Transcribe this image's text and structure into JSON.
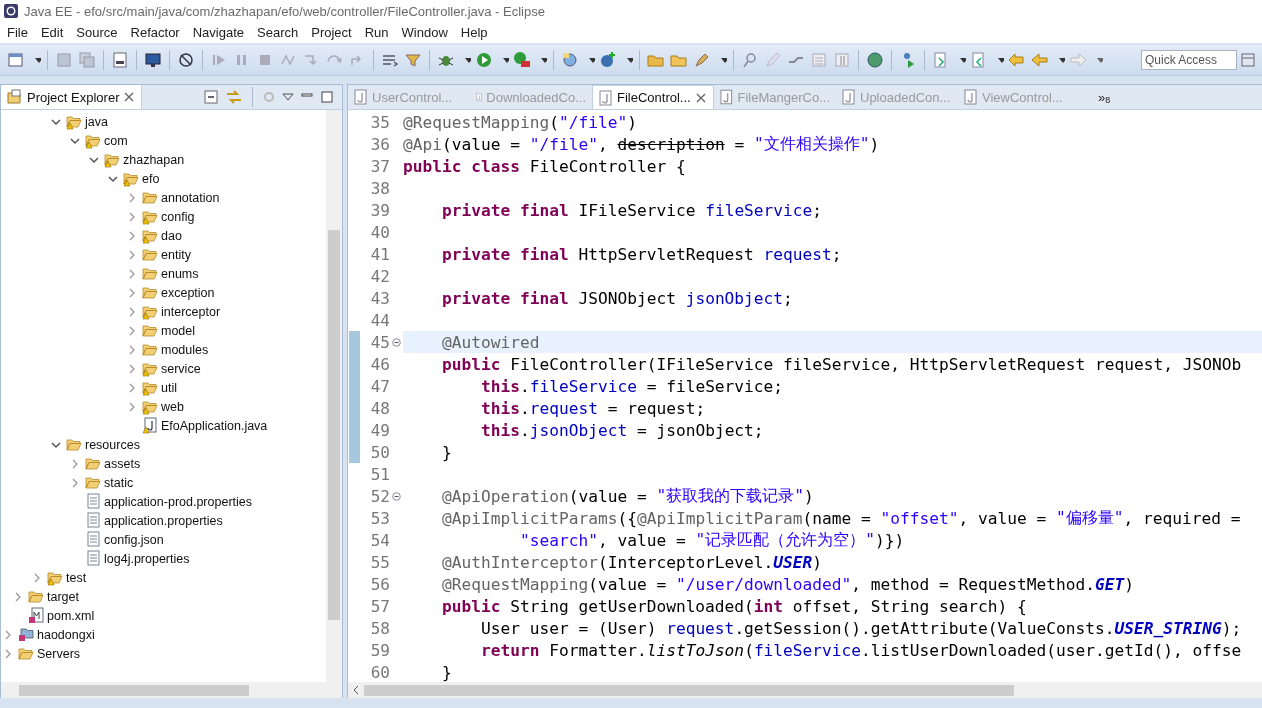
{
  "window": {
    "title": "Java EE - efo/src/main/java/com/zhazhapan/efo/web/controller/FileController.java - Eclipse"
  },
  "menu": [
    "File",
    "Edit",
    "Source",
    "Refactor",
    "Navigate",
    "Search",
    "Project",
    "Run",
    "Window",
    "Help"
  ],
  "quick_access": {
    "placeholder": "Quick Access"
  },
  "explorer": {
    "title": "Project Explorer",
    "tree": [
      {
        "children": [
          {
            "children": [
              {
                "children": [
                  {
                    "label": "java",
                    "kind": "folder",
                    "warning": true,
                    "expanded": true,
                    "children": [
                      {
                        "label": "com",
                        "kind": "folder",
                        "warning": true,
                        "expanded": true,
                        "children": [
                          {
                            "label": "zhazhapan",
                            "kind": "folder",
                            "warning": true,
                            "expanded": true,
                            "children": [
                              {
                                "label": "efo",
                                "kind": "folder",
                                "warning": true,
                                "expanded": true,
                                "children": [
                                  {
                                    "label": "annotation",
                                    "kind": "folder",
                                    "warning": false,
                                    "expanded": false
                                  },
                                  {
                                    "label": "config",
                                    "kind": "folder",
                                    "warning": true,
                                    "expanded": false
                                  },
                                  {
                                    "label": "dao",
                                    "kind": "folder",
                                    "warning": true,
                                    "expanded": false
                                  },
                                  {
                                    "label": "entity",
                                    "kind": "folder",
                                    "warning": false,
                                    "expanded": false
                                  },
                                  {
                                    "label": "enums",
                                    "kind": "folder",
                                    "warning": false,
                                    "expanded": false
                                  },
                                  {
                                    "label": "exception",
                                    "kind": "folder",
                                    "warning": false,
                                    "expanded": false
                                  },
                                  {
                                    "label": "interceptor",
                                    "kind": "folder",
                                    "warning": true,
                                    "expanded": false
                                  },
                                  {
                                    "label": "model",
                                    "kind": "folder",
                                    "warning": false,
                                    "expanded": false
                                  },
                                  {
                                    "label": "modules",
                                    "kind": "folder",
                                    "warning": false,
                                    "expanded": false
                                  },
                                  {
                                    "label": "service",
                                    "kind": "folder",
                                    "warning": true,
                                    "expanded": false
                                  },
                                  {
                                    "label": "util",
                                    "kind": "folder",
                                    "warning": true,
                                    "expanded": false
                                  },
                                  {
                                    "label": "web",
                                    "kind": "folder",
                                    "warning": true,
                                    "expanded": false
                                  },
                                  {
                                    "label": "EfoApplication.java",
                                    "kind": "java-file",
                                    "warning": true
                                  }
                                ]
                              }
                            ]
                          }
                        ]
                      }
                    ]
                  },
                  {
                    "label": "resources",
                    "kind": "folder",
                    "warning": false,
                    "expanded": true,
                    "children": [
                      {
                        "label": "assets",
                        "kind": "folder",
                        "warning": false,
                        "expanded": false
                      },
                      {
                        "label": "static",
                        "kind": "folder",
                        "warning": false,
                        "expanded": false
                      },
                      {
                        "label": "application-prod.properties",
                        "kind": "text-file",
                        "warning": false
                      },
                      {
                        "label": "application.properties",
                        "kind": "text-file",
                        "warning": false
                      },
                      {
                        "label": "config.json",
                        "kind": "text-file",
                        "warning": false
                      },
                      {
                        "label": "log4j.properties",
                        "kind": "text-file",
                        "warning": false
                      }
                    ]
                  }
                ]
              },
              {
                "label": "test",
                "kind": "folder",
                "warning": true,
                "expanded": false
              }
            ]
          },
          {
            "label": "target",
            "kind": "folder",
            "warning": false,
            "expanded": false
          },
          {
            "label": "pom.xml",
            "kind": "xml-file",
            "warning": false
          }
        ]
      },
      {
        "label": "haodongxi",
        "kind": "project",
        "warning": false,
        "expanded": false
      },
      {
        "label": "Servers",
        "kind": "folder",
        "warning": false,
        "expanded": false
      }
    ]
  },
  "editor_tabs": [
    {
      "label": "UserControl...",
      "selected": false
    },
    {
      "label": "DownloadedCo...",
      "selected": false
    },
    {
      "label": "FileControl...",
      "selected": true
    },
    {
      "label": "FileMangerCo...",
      "selected": false
    },
    {
      "label": "UploadedCon...",
      "selected": false
    },
    {
      "label": "ViewControl...",
      "selected": false
    }
  ],
  "hidden_tabs": {
    "arrow": "»",
    "count": "8"
  },
  "code": [
    {
      "n": "35",
      "current": false,
      "changed": false,
      "fold": false,
      "tokens": [
        {
          "kind": "annotation",
          "t": "@RequestMapping"
        },
        {
          "kind": "plain",
          "t": "("
        },
        {
          "kind": "string",
          "t": "\"/file\""
        },
        {
          "kind": "plain",
          "t": ")"
        }
      ]
    },
    {
      "n": "36",
      "current": false,
      "changed": false,
      "fold": false,
      "tokens": [
        {
          "kind": "annotation",
          "t": "@Api"
        },
        {
          "kind": "plain",
          "t": "(value = "
        },
        {
          "kind": "string",
          "t": "\"/file\""
        },
        {
          "kind": "plain",
          "t": ", "
        },
        {
          "kind": "deprecated",
          "t": "description"
        },
        {
          "kind": "plain",
          "t": " = "
        },
        {
          "kind": "string",
          "t": "\"文件相关操作\""
        },
        {
          "kind": "plain",
          "t": ")"
        }
      ]
    },
    {
      "n": "37",
      "current": false,
      "changed": false,
      "fold": false,
      "tokens": [
        {
          "kind": "keyword",
          "t": "public class "
        },
        {
          "kind": "plain",
          "t": "FileController {"
        }
      ]
    },
    {
      "n": "38",
      "current": false,
      "changed": false,
      "fold": false
    },
    {
      "n": "39",
      "current": false,
      "changed": false,
      "fold": false,
      "tokens": [
        {
          "kind": "keyword",
          "t": "    private final "
        },
        {
          "kind": "plain",
          "t": "IFileService "
        },
        {
          "kind": "field",
          "t": "fileService"
        },
        {
          "kind": "plain",
          "t": ";"
        }
      ]
    },
    {
      "n": "40",
      "current": false,
      "changed": false,
      "fold": false
    },
    {
      "n": "41",
      "current": false,
      "changed": false,
      "fold": false,
      "tokens": [
        {
          "kind": "keyword",
          "t": "    private final "
        },
        {
          "kind": "plain",
          "t": "HttpServletRequest "
        },
        {
          "kind": "field",
          "t": "request"
        },
        {
          "kind": "plain",
          "t": ";"
        }
      ]
    },
    {
      "n": "42",
      "current": false,
      "changed": false,
      "fold": false
    },
    {
      "n": "43",
      "current": false,
      "changed": false,
      "fold": false,
      "tokens": [
        {
          "kind": "keyword",
          "t": "    private final "
        },
        {
          "kind": "plain",
          "t": "JSONObject "
        },
        {
          "kind": "field",
          "t": "jsonObject"
        },
        {
          "kind": "plain",
          "t": ";"
        }
      ]
    },
    {
      "n": "44",
      "current": false,
      "changed": false,
      "fold": false
    },
    {
      "n": "45",
      "current": true,
      "changed": true,
      "fold": true,
      "tokens": [
        {
          "kind": "annotation",
          "t": "    @Autowired"
        }
      ]
    },
    {
      "n": "46",
      "current": false,
      "changed": true,
      "fold": false,
      "tokens": [
        {
          "kind": "keyword",
          "t": "    public "
        },
        {
          "kind": "plain",
          "t": "FileController(IFileService fileService, HttpServletRequest request, JSONOb"
        }
      ]
    },
    {
      "n": "47",
      "current": false,
      "changed": true,
      "fold": false,
      "tokens": [
        {
          "kind": "keyword",
          "t": "        this"
        },
        {
          "kind": "plain",
          "t": "."
        },
        {
          "kind": "field",
          "t": "fileService"
        },
        {
          "kind": "plain",
          "t": " = fileService;"
        }
      ]
    },
    {
      "n": "48",
      "current": false,
      "changed": true,
      "fold": false,
      "tokens": [
        {
          "kind": "keyword",
          "t": "        this"
        },
        {
          "kind": "plain",
          "t": "."
        },
        {
          "kind": "field",
          "t": "request"
        },
        {
          "kind": "plain",
          "t": " = request;"
        }
      ]
    },
    {
      "n": "49",
      "current": false,
      "changed": true,
      "fold": false,
      "tokens": [
        {
          "kind": "keyword",
          "t": "        this"
        },
        {
          "kind": "plain",
          "t": "."
        },
        {
          "kind": "field",
          "t": "jsonObject"
        },
        {
          "kind": "plain",
          "t": " = jsonObject;"
        }
      ]
    },
    {
      "n": "50",
      "current": false,
      "changed": true,
      "fold": false,
      "tokens": [
        {
          "kind": "plain",
          "t": "    }"
        }
      ]
    },
    {
      "n": "51",
      "current": false,
      "changed": false,
      "fold": false
    },
    {
      "n": "52",
      "current": false,
      "changed": false,
      "fold": true,
      "tokens": [
        {
          "kind": "annotation",
          "t": "    @ApiOperation"
        },
        {
          "kind": "plain",
          "t": "(value = "
        },
        {
          "kind": "string",
          "t": "\"获取我的下载记录\""
        },
        {
          "kind": "plain",
          "t": ")"
        }
      ]
    },
    {
      "n": "53",
      "current": false,
      "changed": false,
      "fold": false,
      "tokens": [
        {
          "kind": "annotation",
          "t": "    @ApiImplicitParams"
        },
        {
          "kind": "plain",
          "t": "({"
        },
        {
          "kind": "annotation",
          "t": "@ApiImplicitParam"
        },
        {
          "kind": "plain",
          "t": "(name = "
        },
        {
          "kind": "string",
          "t": "\"offset\""
        },
        {
          "kind": "plain",
          "t": ", value = "
        },
        {
          "kind": "string",
          "t": "\"偏移量\""
        },
        {
          "kind": "plain",
          "t": ", required ="
        }
      ]
    },
    {
      "n": "54",
      "current": false,
      "changed": false,
      "fold": false,
      "tokens": [
        {
          "kind": "string",
          "t": "            \"search\""
        },
        {
          "kind": "plain",
          "t": ", value = "
        },
        {
          "kind": "string",
          "t": "\"记录匹配（允许为空）\""
        },
        {
          "kind": "plain",
          "t": ")})"
        }
      ]
    },
    {
      "n": "55",
      "current": false,
      "changed": false,
      "fold": false,
      "tokens": [
        {
          "kind": "annotation",
          "t": "    @AuthInterceptor"
        },
        {
          "kind": "plain",
          "t": "(InterceptorLevel."
        },
        {
          "kind": "constant",
          "t": "USER"
        },
        {
          "kind": "plain",
          "t": ")"
        }
      ]
    },
    {
      "n": "56",
      "current": false,
      "changed": false,
      "fold": false,
      "tokens": [
        {
          "kind": "annotation",
          "t": "    @RequestMapping"
        },
        {
          "kind": "plain",
          "t": "(value = "
        },
        {
          "kind": "string",
          "t": "\"/user/downloaded\""
        },
        {
          "kind": "plain",
          "t": ", method = RequestMethod."
        },
        {
          "kind": "constant",
          "t": "GET"
        },
        {
          "kind": "plain",
          "t": ")"
        }
      ]
    },
    {
      "n": "57",
      "current": false,
      "changed": false,
      "fold": false,
      "tokens": [
        {
          "kind": "keyword",
          "t": "    public "
        },
        {
          "kind": "plain",
          "t": "String getUserDownloaded("
        },
        {
          "kind": "keyword",
          "t": "int "
        },
        {
          "kind": "plain",
          "t": "offset, String search) {"
        }
      ]
    },
    {
      "n": "58",
      "current": false,
      "changed": false,
      "fold": false,
      "tokens": [
        {
          "kind": "plain",
          "t": "        User user = (User) "
        },
        {
          "kind": "field",
          "t": "request"
        },
        {
          "kind": "plain",
          "t": ".getSession().getAttribute(ValueConsts."
        },
        {
          "kind": "constant",
          "t": "USER_STRING"
        },
        {
          "kind": "plain",
          "t": ");"
        }
      ]
    },
    {
      "n": "59",
      "current": false,
      "changed": false,
      "fold": false,
      "tokens": [
        {
          "kind": "keyword",
          "t": "        return "
        },
        {
          "kind": "plain",
          "t": "Formatter."
        },
        {
          "kind": "static-method",
          "t": "listToJson"
        },
        {
          "kind": "plain",
          "t": "("
        },
        {
          "kind": "field",
          "t": "fileService"
        },
        {
          "kind": "plain",
          "t": ".listUserDownloaded(user.getId(), offse"
        }
      ]
    },
    {
      "n": "60",
      "current": false,
      "changed": false,
      "fold": false,
      "tokens": [
        {
          "kind": "plain",
          "t": "    }"
        }
      ]
    }
  ]
}
